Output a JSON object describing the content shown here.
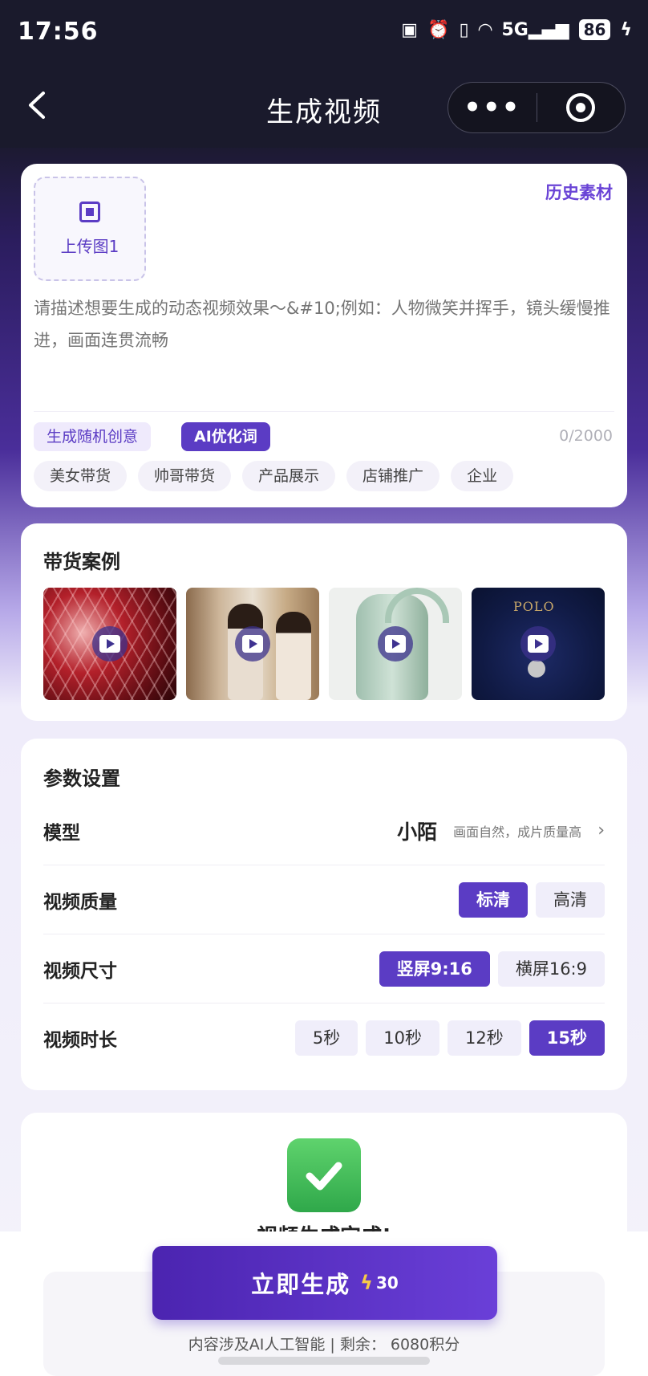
{
  "status_bar": {
    "time": "17:56",
    "signal": "5G",
    "battery": "86"
  },
  "nav": {
    "title": "生成视频",
    "more": "•••"
  },
  "prompt_card": {
    "upload_label": "上传图1",
    "history_link": "历史素材",
    "prompt_placeholder": "请描述想要生成的动态视频效果～&#10;例如：人物微笑并挥手，镜头缓慢推进，画面连贯流畅",
    "random_chip": "生成随机创意",
    "ai_chip": "AI优化词",
    "char_count": "0/2000",
    "tags": [
      "美女带货",
      "帅哥带货",
      "产品展示",
      "店铺推广",
      "企业"
    ]
  },
  "cases": {
    "title": "带货案例",
    "thumb_text": "POLO"
  },
  "params": {
    "title": "参数设置",
    "model": {
      "label": "模型",
      "value": "小陌",
      "desc": "画面自然，成片质量高"
    },
    "quality": {
      "label": "视频质量",
      "options": [
        "标清",
        "高清"
      ],
      "selected": "标清"
    },
    "size": {
      "label": "视频尺寸",
      "options": [
        "竖屏9:16",
        "横屏16:9"
      ],
      "selected": "竖屏9:16"
    },
    "duration": {
      "label": "视频时长",
      "options": [
        "5秒",
        "10秒",
        "12秒",
        "15秒"
      ],
      "selected": "15秒"
    }
  },
  "result": {
    "title": "视频生成完成!"
  },
  "footer": {
    "generate_label": "立即生成",
    "cost": "30",
    "note": "内容涉及AI人工智能 | 剩余： 6080积分"
  },
  "colors": {
    "accent": "#5b3cc4",
    "nav_bg": "#1a1a2c",
    "success": "#3db554"
  }
}
